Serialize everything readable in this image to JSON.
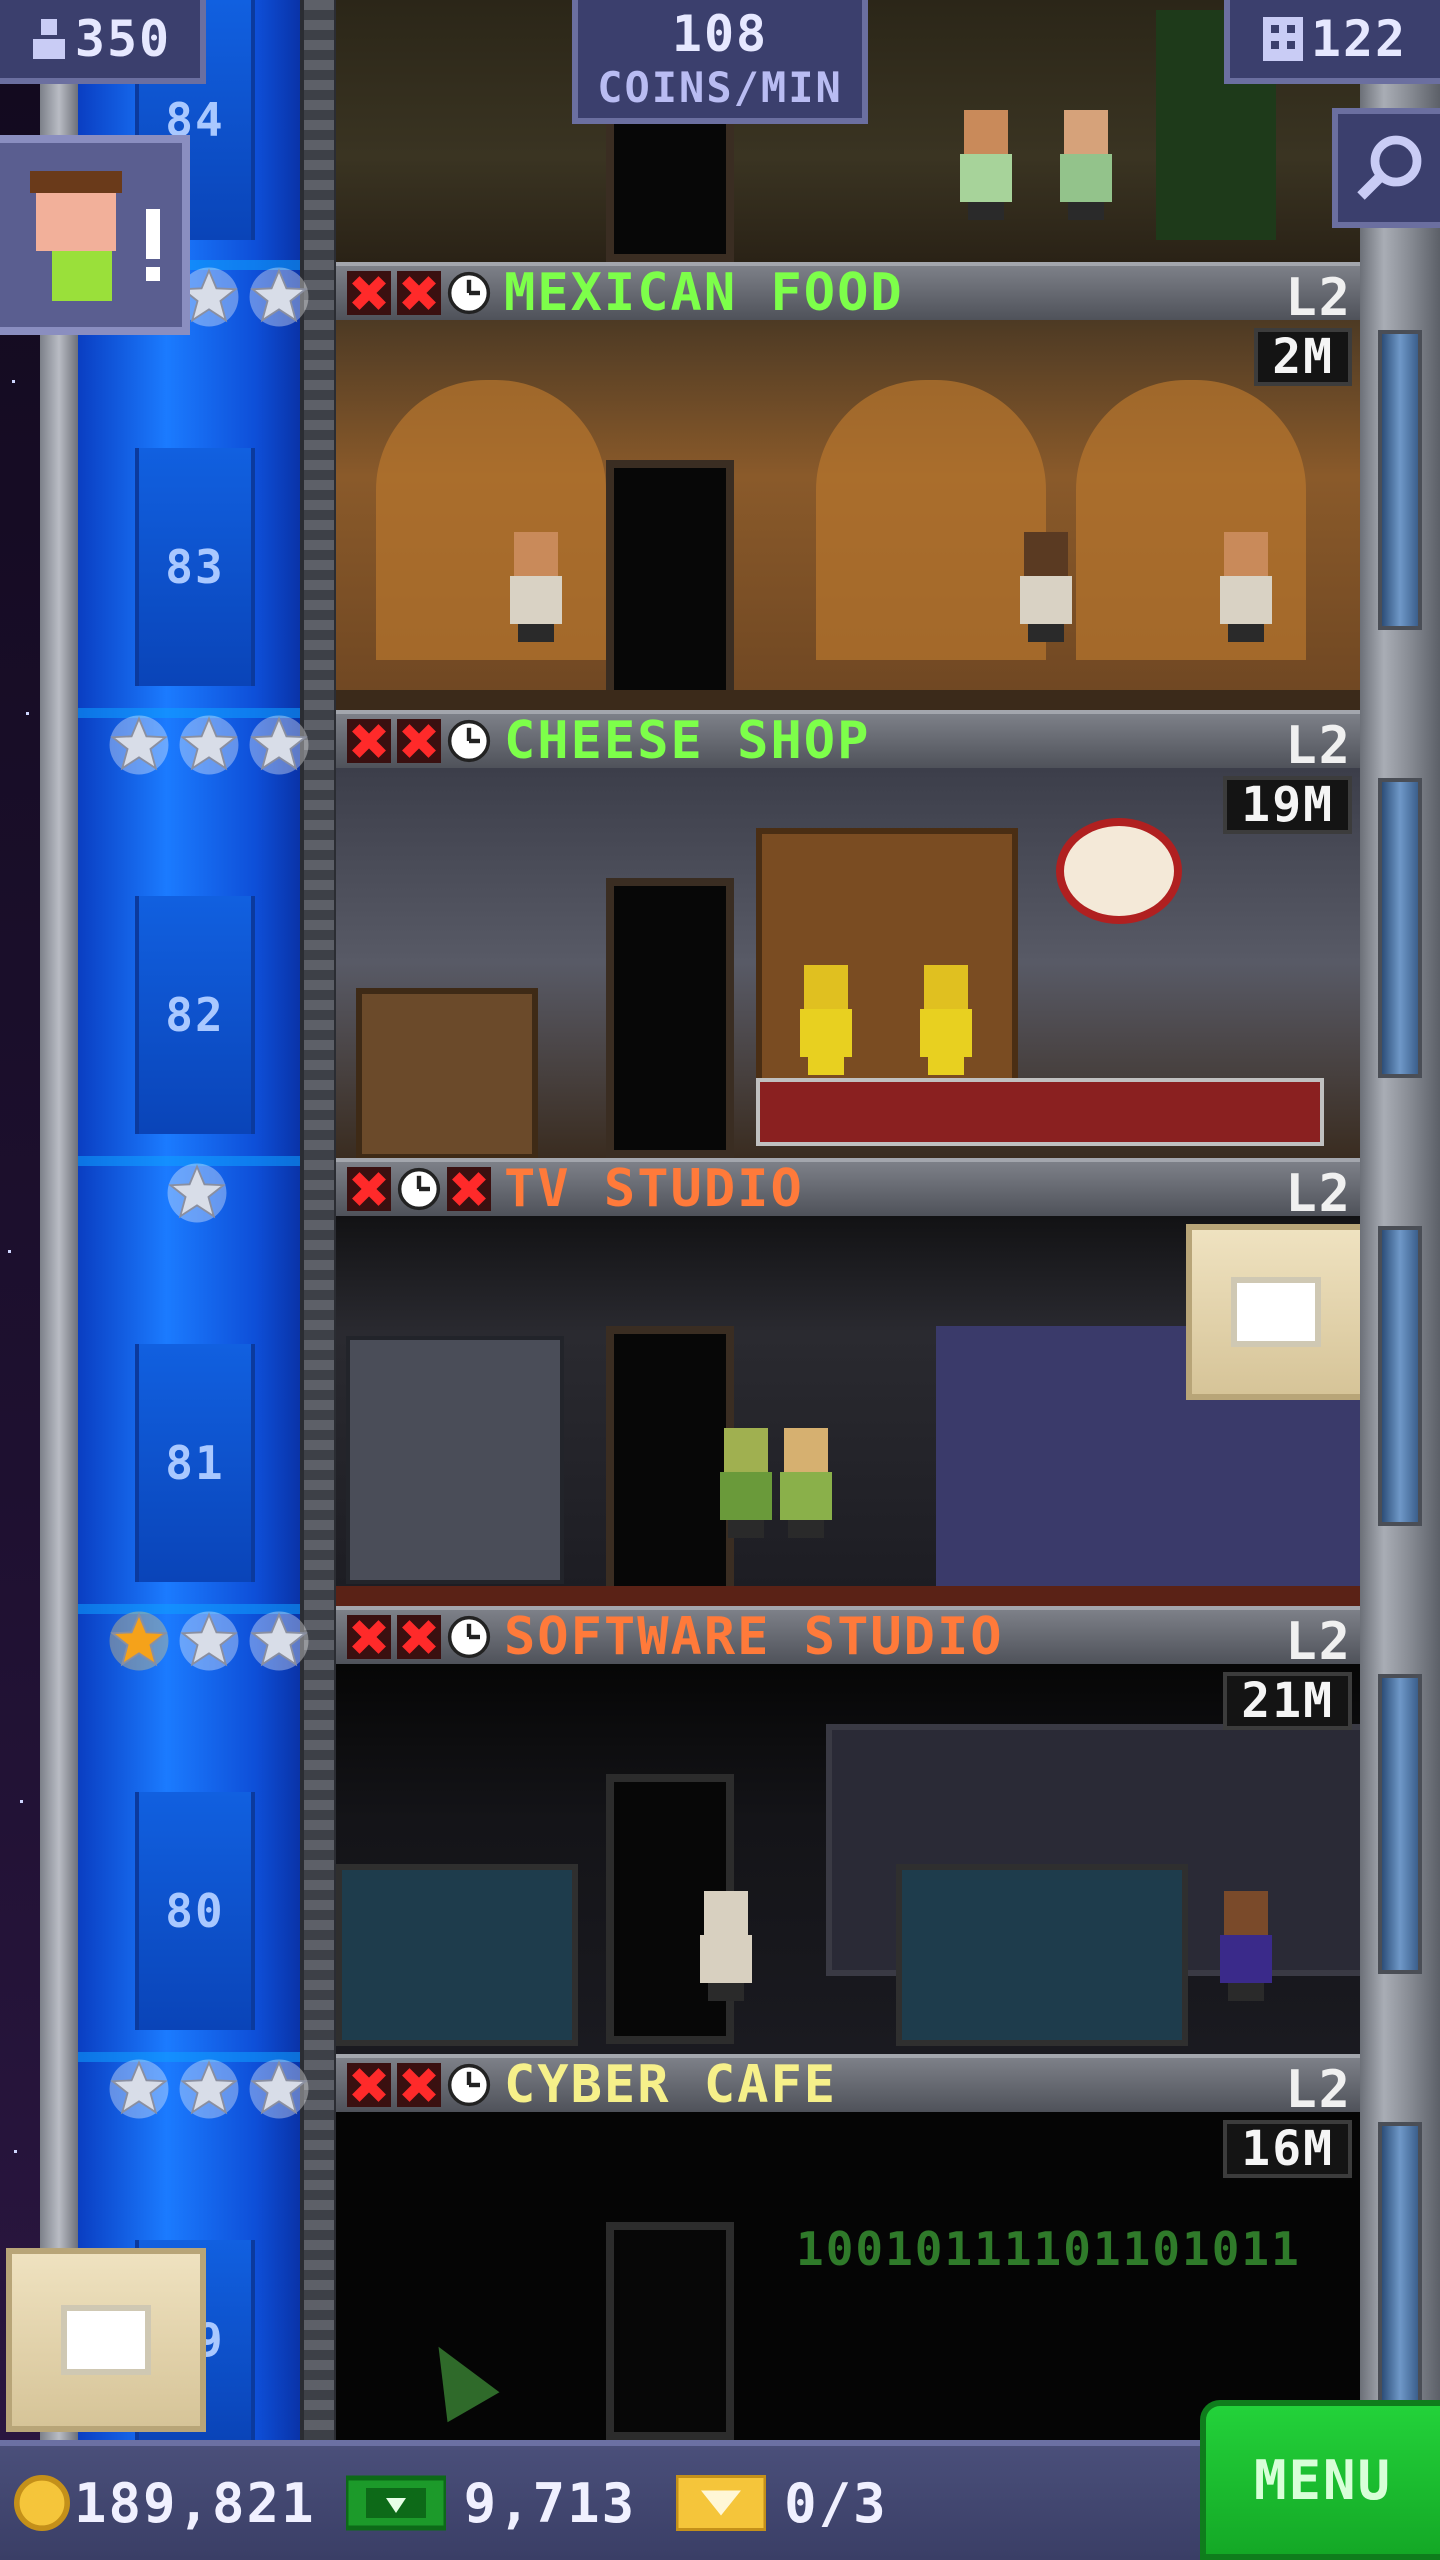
{
  "hud": {
    "population": "350",
    "coins_rate_value": "108",
    "coins_rate_label": "COINS/MIN",
    "floors_count": "122"
  },
  "shaft_floors": [
    {
      "number": "84"
    },
    {
      "number": "83"
    },
    {
      "number": "82"
    },
    {
      "number": "81"
    },
    {
      "number": "80"
    },
    {
      "number": "79"
    }
  ],
  "floors": [
    {
      "name": "MEXICAN FOOD",
      "level": "L2",
      "timer": "2M",
      "name_color": "#7dff4a",
      "status": [
        "x",
        "x",
        "clock"
      ],
      "stars": [
        "silver",
        "silver",
        "silver"
      ]
    },
    {
      "name": "CHEESE SHOP",
      "level": "L2",
      "timer": "19M",
      "name_color": "#7dff4a",
      "status": [
        "x",
        "x",
        "clock"
      ],
      "stars": [
        "silver",
        "silver",
        "silver"
      ]
    },
    {
      "name": "TV STUDIO",
      "level": "L2",
      "timer": "",
      "name_color": "#ff7a3a",
      "status": [
        "x",
        "clock",
        "x"
      ],
      "stars": [
        "silver"
      ]
    },
    {
      "name": "SOFTWARE STUDIO",
      "level": "L2",
      "timer": "21M",
      "name_color": "#ff7a3a",
      "status": [
        "x",
        "x",
        "clock"
      ],
      "stars": [
        "gold",
        "silver",
        "silver"
      ]
    },
    {
      "name": "CYBER CAFE",
      "level": "L2",
      "timer": "16M",
      "name_color": "#f6f08a",
      "status": [
        "x",
        "x",
        "clock"
      ],
      "stars": [
        "silver",
        "silver",
        "silver"
      ]
    }
  ],
  "cyber_cafe_binary": "10010111101101011",
  "bottom_bar": {
    "coins": "189,821",
    "bux": "9,713",
    "tickets": "0/3",
    "menu_label": "MENU"
  },
  "colors": {
    "accent_green": "#23d23a",
    "hud_purple": "#3b3f6d",
    "shaft_blue": "#1b7bff"
  },
  "icons": [
    "population-icon",
    "floors-icon",
    "search-icon",
    "coin-icon",
    "bux-icon",
    "ticket-icon",
    "box-icon",
    "star-icon",
    "close-icon",
    "clock-icon"
  ]
}
